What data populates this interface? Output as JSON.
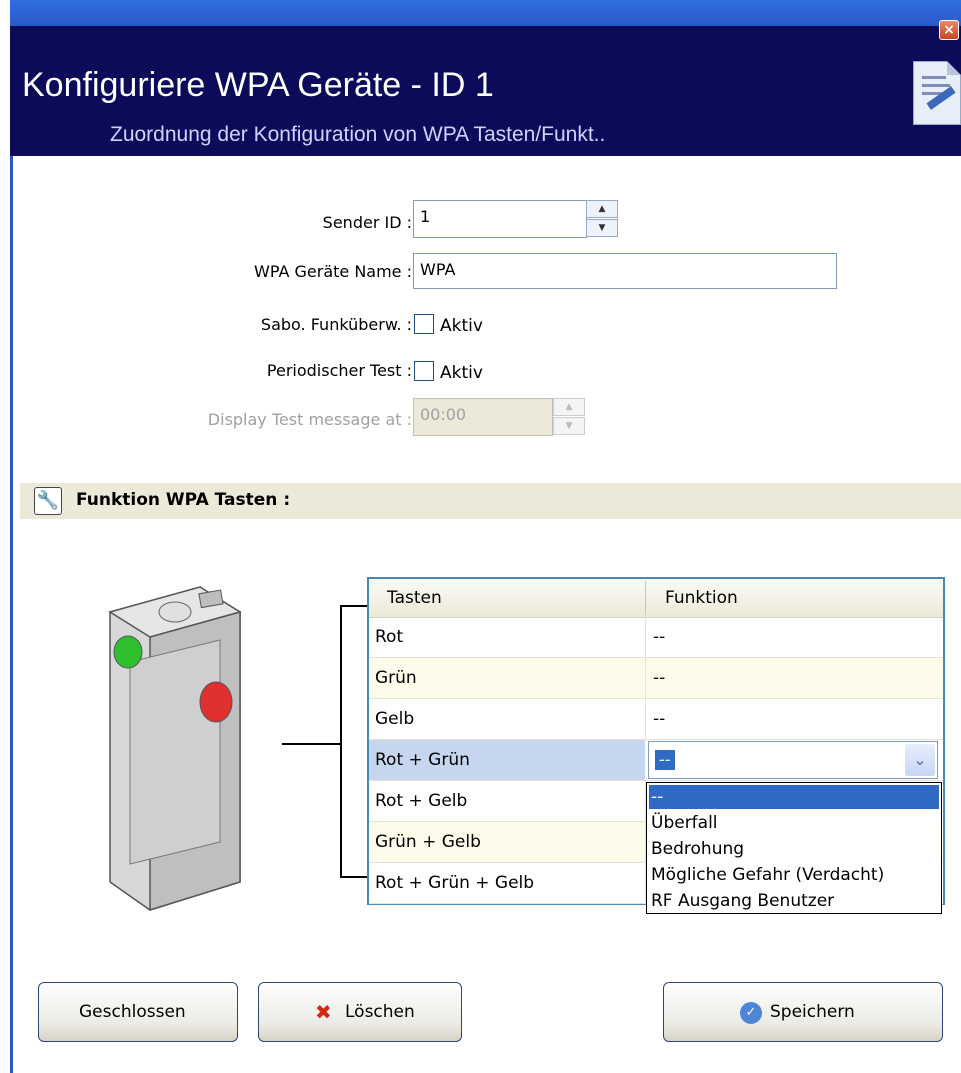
{
  "window": {
    "close_icon": "close-icon",
    "title": "Konfiguriere WPA Geräte - ID 1",
    "subtitle": "Zuordnung der Konfiguration von  WPA Tasten/Funkt.."
  },
  "form": {
    "sender_id_label": "Sender ID :",
    "sender_id_value": "1",
    "name_label": "WPA Geräte Name :",
    "name_value": "WPA",
    "sabo_label": "Sabo. Funküberw. :",
    "sabo_checkbox_label": "Aktiv",
    "periodic_label": "Periodischer Test :",
    "periodic_checkbox_label": "Aktiv",
    "display_test_label": "Display Test message at :",
    "display_test_value": "00:00"
  },
  "section": {
    "title": "Funktion WPA Tasten :",
    "icon": "wrench-icon"
  },
  "grid": {
    "headers": [
      "Tasten",
      "Funktion"
    ],
    "rows": [
      {
        "key": "Rot",
        "value": "--"
      },
      {
        "key": "Grün",
        "value": "--"
      },
      {
        "key": "Gelb",
        "value": "--"
      },
      {
        "key": "Rot + Grün",
        "value": "--"
      },
      {
        "key": "Rot + Gelb",
        "value": ""
      },
      {
        "key": "Grün + Gelb",
        "value": ""
      },
      {
        "key": "Rot + Grün + Gelb",
        "value": ""
      }
    ],
    "combo_value": "--",
    "dropdown_options": [
      "--",
      "Überfall",
      "Bedrohung",
      "Mögliche Gefahr (Verdacht)",
      "RF Ausgang Benutzer"
    ]
  },
  "buttons": {
    "close": "Geschlossen",
    "delete": "Löschen",
    "save": "Speichern"
  },
  "colors": {
    "header_bg": "#0b0b5a",
    "titlebar": "#2a58c8",
    "selection": "#316ac5",
    "red_button": "#e03030",
    "green_button": "#2ec02e"
  }
}
